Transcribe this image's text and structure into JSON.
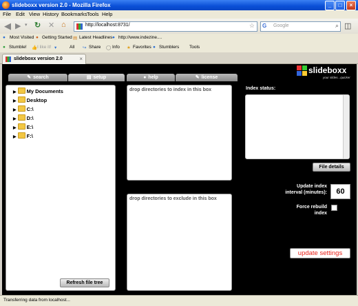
{
  "window": {
    "title": "slideboxx version 2.0 - Mozilla Firefox"
  },
  "menu": [
    "File",
    "Edit",
    "View",
    "History",
    "Bookmarks",
    "Tools",
    "Help"
  ],
  "nav": {
    "url": "http://localhost:8731/",
    "search_placeholder": "Google"
  },
  "bookmarks": [
    "Most Visited",
    "Getting Started",
    "Latest Headlines",
    "http://www.indezine...."
  ],
  "stumble": {
    "stumble": "Stumble!",
    "like": "I like it!",
    "all": "All",
    "share": "Share",
    "info": "Info",
    "favorites": "Favorites",
    "stumblers": "Stumblers",
    "tools": "Tools"
  },
  "tab": {
    "title": "slideboxx version 2.0"
  },
  "app": {
    "tabs": [
      "search",
      "setup",
      "help",
      "license"
    ],
    "active_tab": "setup",
    "logo": {
      "word": "slideboxx",
      "tagline": "your slides...quicker"
    },
    "tree": [
      "My Documents",
      "Desktop",
      "C:\\",
      "D:\\",
      "E:\\",
      "F:\\"
    ],
    "refresh_button": "Refresh file tree",
    "include_box_title": "drop directories to index in this box",
    "exclude_box_title": "drop directories to exclude in this box",
    "index_status_label": "Index status:",
    "file_details_button": "File details",
    "update_interval_label_1": "Update index",
    "update_interval_label_2": "interval (minutes):",
    "update_interval_value": "60",
    "force_rebuild_label_1": "Force rebuild",
    "force_rebuild_label_2": "index",
    "update_settings_button": "update settings",
    "colors": {
      "update_settings_text": "#e8221a",
      "background": "#000000"
    }
  },
  "status": "Transferring data from localhost..."
}
